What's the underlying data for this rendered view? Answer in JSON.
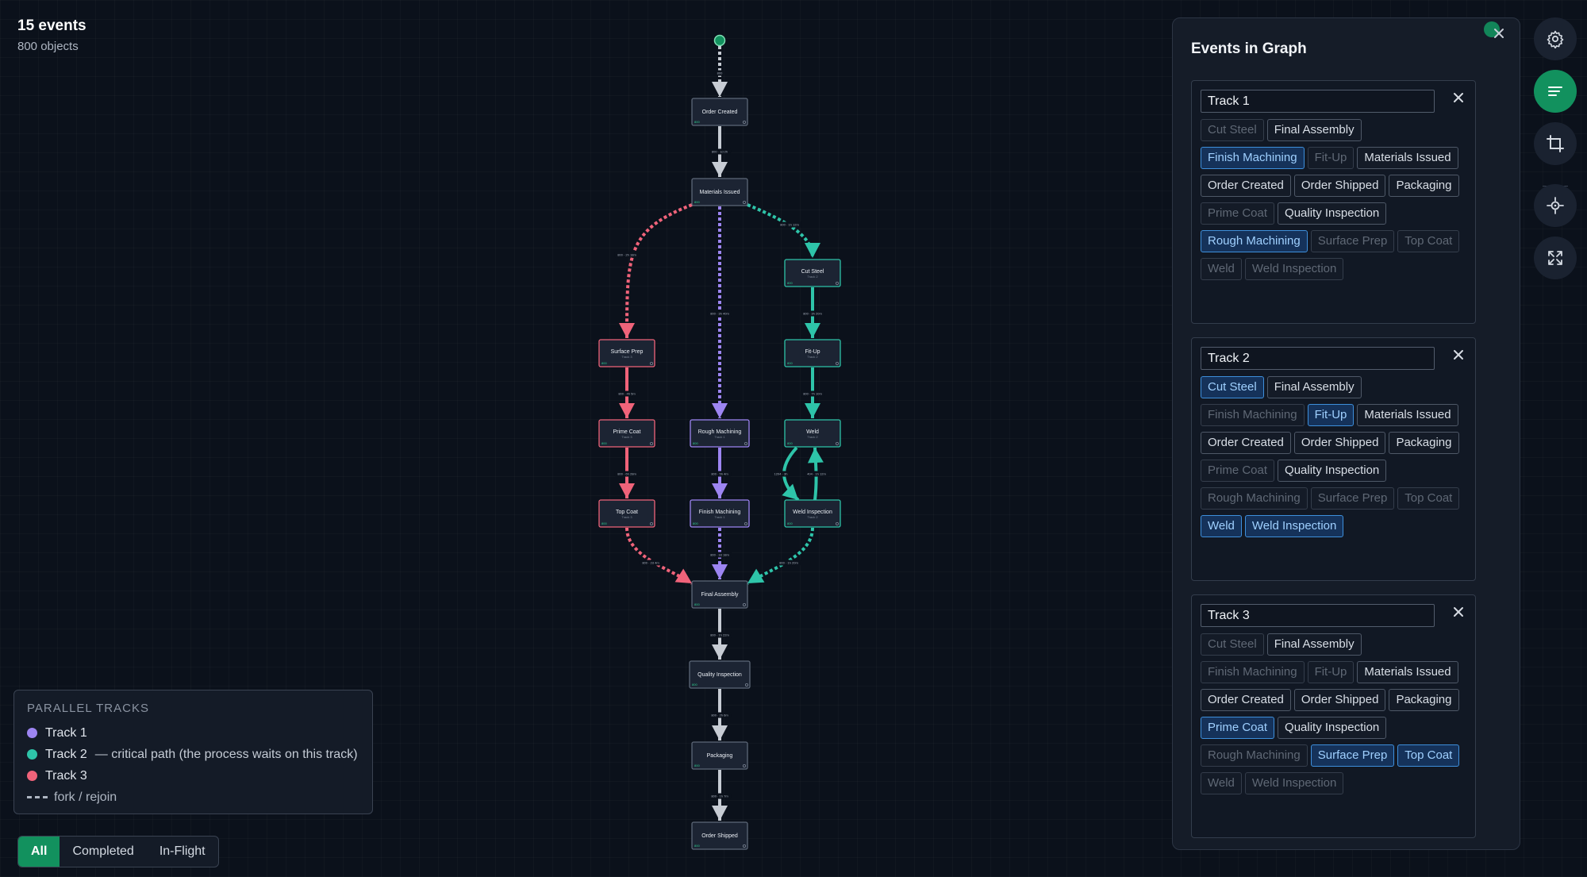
{
  "stats": {
    "events": "15 events",
    "objects": "800 objects"
  },
  "colors": {
    "track1": "#9d85f2",
    "track2": "#2ec4a9",
    "track3": "#f0637a",
    "shared": "#c7ccd4",
    "accent": "#12915e"
  },
  "graph": {
    "nodes": [
      {
        "id": "order-created",
        "label": "Order Created",
        "sub": "",
        "count": "800",
        "track": "shared"
      },
      {
        "id": "materials-issued",
        "label": "Materials Issued",
        "sub": "",
        "count": "800",
        "track": "shared"
      },
      {
        "id": "surface-prep",
        "label": "Surface Prep",
        "sub": "Track 3",
        "count": "800",
        "track": "track3"
      },
      {
        "id": "prime-coat",
        "label": "Prime Coat",
        "sub": "Track 3",
        "count": "800",
        "track": "track3"
      },
      {
        "id": "top-coat",
        "label": "Top Coat",
        "sub": "Track 3",
        "count": "800",
        "track": "track3"
      },
      {
        "id": "rough-machining",
        "label": "Rough Machining",
        "sub": "Track 1",
        "count": "800",
        "track": "track1"
      },
      {
        "id": "finish-machining",
        "label": "Finish Machining",
        "sub": "Track 1",
        "count": "800",
        "track": "track1"
      },
      {
        "id": "cut-steel",
        "label": "Cut Steel",
        "sub": "Track 2",
        "count": "800",
        "track": "track2"
      },
      {
        "id": "fit-up",
        "label": "Fit-Up",
        "sub": "Track 2",
        "count": "800",
        "track": "track2"
      },
      {
        "id": "weld",
        "label": "Weld",
        "sub": "Track 2",
        "count": "800",
        "track": "track2"
      },
      {
        "id": "weld-inspection",
        "label": "Weld Inspection",
        "sub": "Track 2",
        "count": "800",
        "track": "track2"
      },
      {
        "id": "final-assembly",
        "label": "Final Assembly",
        "sub": "",
        "count": "800",
        "track": "shared"
      },
      {
        "id": "quality-inspection",
        "label": "Quality Inspection",
        "sub": "",
        "count": "800",
        "track": "shared"
      },
      {
        "id": "packaging",
        "label": "Packaging",
        "sub": "",
        "count": "800",
        "track": "shared"
      },
      {
        "id": "order-shipped",
        "label": "Order Shipped",
        "sub": "",
        "count": "800",
        "track": "shared"
      }
    ],
    "edges": [
      {
        "from": "start",
        "to": "order-created",
        "label": "800",
        "track": "shared",
        "dashed": true
      },
      {
        "from": "order-created",
        "to": "materials-issued",
        "label": "800 · 1d 2h",
        "track": "shared",
        "dashed": false
      },
      {
        "from": "materials-issued",
        "to": "surface-prep",
        "label": "800 · 2h 18m",
        "track": "track3",
        "dashed": true
      },
      {
        "from": "materials-issued",
        "to": "rough-machining",
        "label": "800 · 3h 40m",
        "track": "track1",
        "dashed": true
      },
      {
        "from": "materials-issued",
        "to": "cut-steel",
        "label": "800 · 1h 12m",
        "track": "track2",
        "dashed": true
      },
      {
        "from": "surface-prep",
        "to": "prime-coat",
        "label": "800 · 4h 5m",
        "track": "track3",
        "dashed": false
      },
      {
        "from": "prime-coat",
        "to": "top-coat",
        "label": "800 · 6h 28m",
        "track": "track3",
        "dashed": false
      },
      {
        "from": "rough-machining",
        "to": "finish-machining",
        "label": "800 · 5h 4m",
        "track": "track1",
        "dashed": false
      },
      {
        "from": "cut-steel",
        "to": "fit-up",
        "label": "800 · 3h 20m",
        "track": "track2",
        "dashed": false
      },
      {
        "from": "fit-up",
        "to": "weld",
        "label": "800 · 7h 10m",
        "track": "track2",
        "dashed": false
      },
      {
        "from": "weld",
        "to": "weld-inspection",
        "label": "1204 · 3h",
        "track": "track2",
        "dashed": false
      },
      {
        "from": "weld-inspection",
        "to": "weld",
        "label": "404 · 1h 12m",
        "track": "track2",
        "dashed": false
      },
      {
        "from": "top-coat",
        "to": "final-assembly",
        "label": "800 · 2d 4m",
        "track": "track3",
        "dashed": true
      },
      {
        "from": "finish-machining",
        "to": "final-assembly",
        "label": "800 · 3d 18m",
        "track": "track1",
        "dashed": true
      },
      {
        "from": "weld-inspection",
        "to": "final-assembly",
        "label": "800 · 1h 20m",
        "track": "track2",
        "dashed": true
      },
      {
        "from": "final-assembly",
        "to": "quality-inspection",
        "label": "800 · 1h 22m",
        "track": "shared",
        "dashed": false
      },
      {
        "from": "quality-inspection",
        "to": "packaging",
        "label": "800 · 2h 6m",
        "track": "shared",
        "dashed": false
      },
      {
        "from": "packaging",
        "to": "order-shipped",
        "label": "800 · 1h 7m",
        "track": "shared",
        "dashed": false
      }
    ]
  },
  "legend": {
    "title": "PARALLEL TRACKS",
    "track1": "Track 1",
    "track2": "Track 2",
    "track2_note": "— critical path (the process waits on this track)",
    "track3": "Track 3",
    "fork": "fork / rejoin"
  },
  "filter": {
    "all": "All",
    "completed": "Completed",
    "inflight": "In-Flight",
    "active": "All"
  },
  "panel": {
    "title": "Events in Graph",
    "tracks": [
      {
        "name": "Track 1",
        "chips": [
          {
            "label": "Cut Steel",
            "state": "dim"
          },
          {
            "label": "Final Assembly",
            "state": "normal"
          },
          {
            "label": "Finish Machining",
            "state": "sel"
          },
          {
            "label": "Fit-Up",
            "state": "dim"
          },
          {
            "label": "Materials Issued",
            "state": "normal"
          },
          {
            "label": "Order Created",
            "state": "normal"
          },
          {
            "label": "Order Shipped",
            "state": "normal"
          },
          {
            "label": "Packaging",
            "state": "normal"
          },
          {
            "label": "Prime Coat",
            "state": "dim"
          },
          {
            "label": "Quality Inspection",
            "state": "normal"
          },
          {
            "label": "Rough Machining",
            "state": "sel"
          },
          {
            "label": "Surface Prep",
            "state": "dim"
          },
          {
            "label": "Top Coat",
            "state": "dim"
          },
          {
            "label": "Weld",
            "state": "dim"
          },
          {
            "label": "Weld Inspection",
            "state": "dim"
          }
        ]
      },
      {
        "name": "Track 2",
        "chips": [
          {
            "label": "Cut Steel",
            "state": "sel"
          },
          {
            "label": "Final Assembly",
            "state": "normal"
          },
          {
            "label": "Finish Machining",
            "state": "dim"
          },
          {
            "label": "Fit-Up",
            "state": "sel"
          },
          {
            "label": "Materials Issued",
            "state": "normal"
          },
          {
            "label": "Order Created",
            "state": "normal"
          },
          {
            "label": "Order Shipped",
            "state": "normal"
          },
          {
            "label": "Packaging",
            "state": "normal"
          },
          {
            "label": "Prime Coat",
            "state": "dim"
          },
          {
            "label": "Quality Inspection",
            "state": "normal"
          },
          {
            "label": "Rough Machining",
            "state": "dim"
          },
          {
            "label": "Surface Prep",
            "state": "dim"
          },
          {
            "label": "Top Coat",
            "state": "dim"
          },
          {
            "label": "Weld",
            "state": "sel"
          },
          {
            "label": "Weld Inspection",
            "state": "sel"
          }
        ]
      },
      {
        "name": "Track 3",
        "chips": [
          {
            "label": "Cut Steel",
            "state": "dim"
          },
          {
            "label": "Final Assembly",
            "state": "normal"
          },
          {
            "label": "Finish Machining",
            "state": "dim"
          },
          {
            "label": "Fit-Up",
            "state": "dim"
          },
          {
            "label": "Materials Issued",
            "state": "normal"
          },
          {
            "label": "Order Created",
            "state": "normal"
          },
          {
            "label": "Order Shipped",
            "state": "normal"
          },
          {
            "label": "Packaging",
            "state": "normal"
          },
          {
            "label": "Prime Coat",
            "state": "sel"
          },
          {
            "label": "Quality Inspection",
            "state": "normal"
          },
          {
            "label": "Rough Machining",
            "state": "dim"
          },
          {
            "label": "Surface Prep",
            "state": "sel"
          },
          {
            "label": "Top Coat",
            "state": "sel"
          },
          {
            "label": "Weld",
            "state": "dim"
          },
          {
            "label": "Weld Inspection",
            "state": "dim"
          }
        ]
      }
    ]
  },
  "toolbar": {
    "buttons": [
      {
        "name": "settings-button",
        "icon": "gear-icon"
      },
      {
        "name": "list-button",
        "icon": "list-icon",
        "active": true
      },
      {
        "name": "crop-button",
        "icon": "crop-icon"
      },
      {
        "name": "center-button",
        "icon": "crosshair-icon"
      },
      {
        "name": "fullscreen-button",
        "icon": "expand-icon"
      }
    ]
  }
}
